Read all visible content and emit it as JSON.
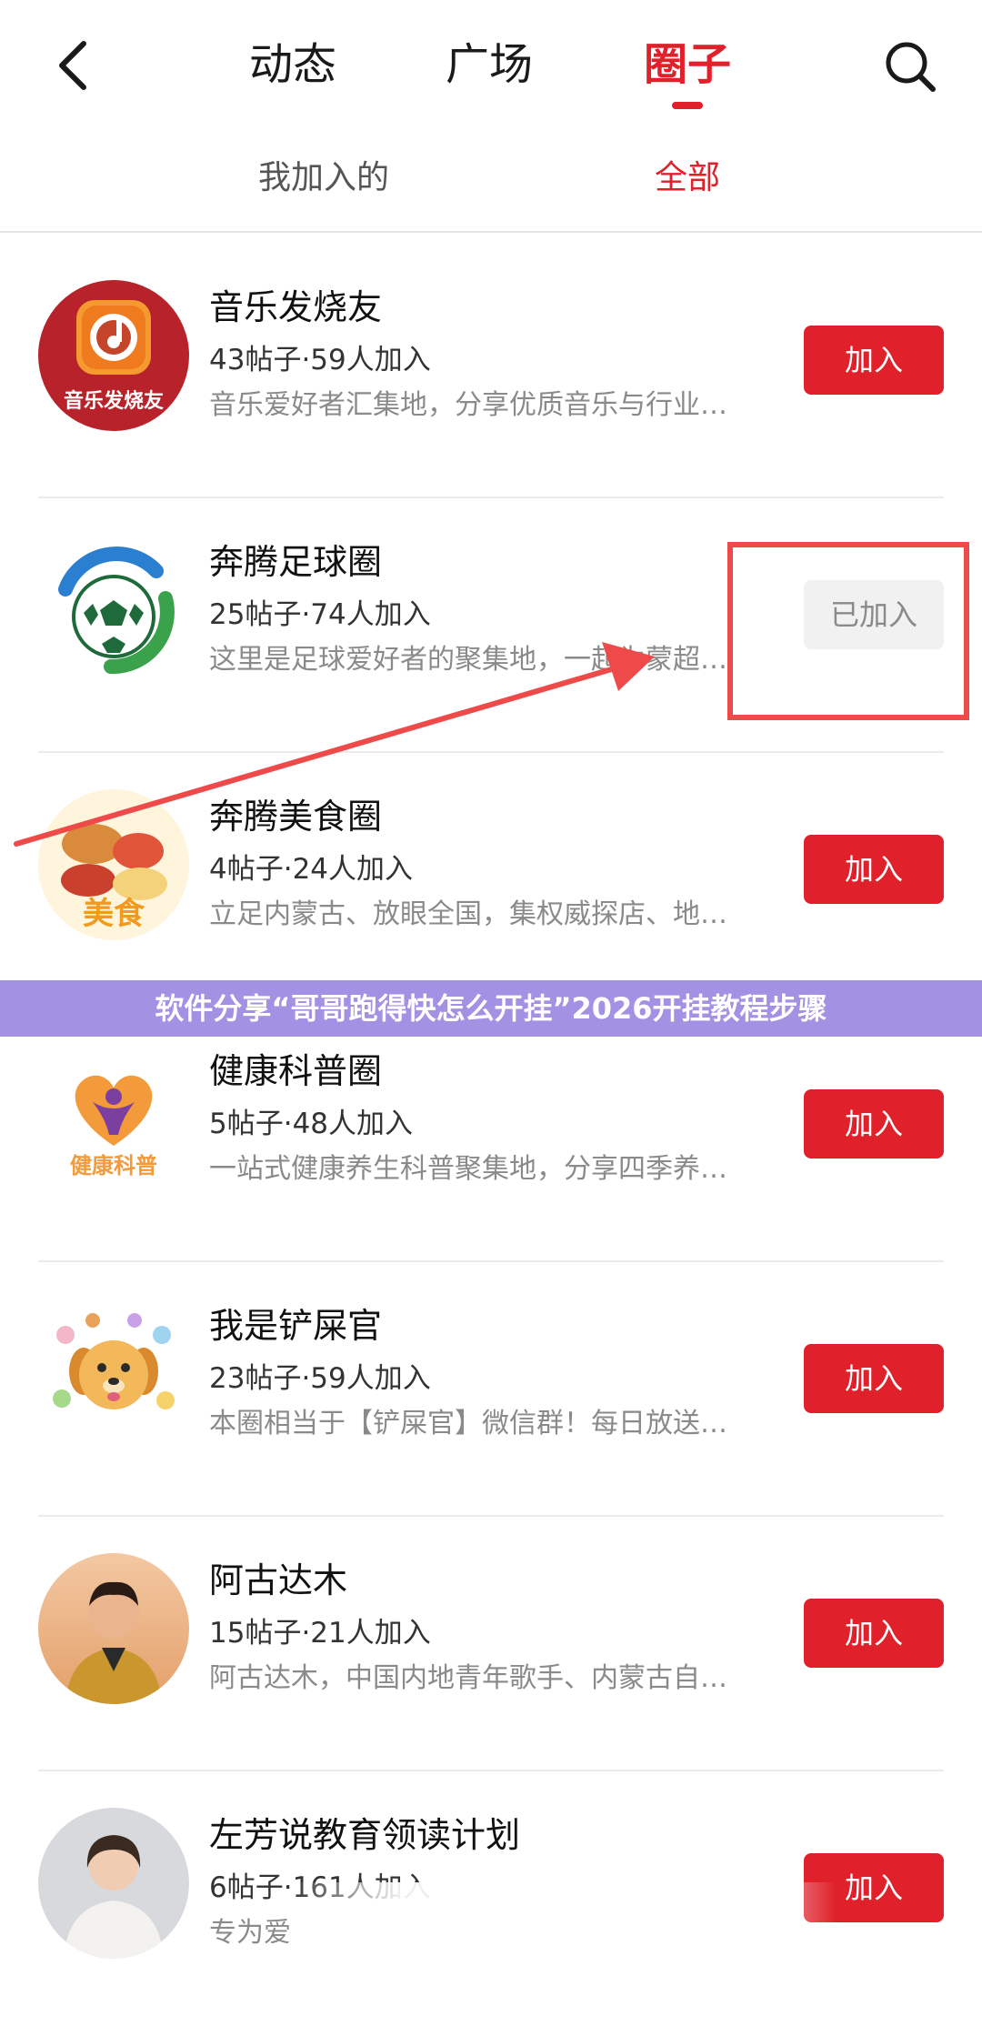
{
  "header": {
    "tabs": [
      {
        "label": "动态"
      },
      {
        "label": "广场"
      },
      {
        "label": "圈子"
      }
    ],
    "active_tab": "圈子",
    "back_icon": "chevron-left-icon",
    "search_icon": "search-icon"
  },
  "subtabs": [
    {
      "label": "我加入的"
    },
    {
      "label": "全部"
    }
  ],
  "active_subtab": "全部",
  "items": [
    {
      "title": "音乐发烧友",
      "stats": "43帖子·59人加入",
      "desc": "音乐爱好者汇集地，分享优质音乐与行业…",
      "button": "加入",
      "avatar_text": "音乐发烧友"
    },
    {
      "title": "奔腾足球圈",
      "stats": "25帖子·74人加入",
      "desc": "这里是足球爱好者的聚集地，一起为蒙超…",
      "button": "已加入"
    },
    {
      "title": "奔腾美食圈",
      "stats": "4帖子·24人加入",
      "desc": "立足内蒙古、放眼全国，集权威探店、地…",
      "button": "加入",
      "avatar_text": "美食"
    },
    {
      "title": "健康科普圈",
      "stats": "5帖子·48人加入",
      "desc": "一站式健康养生科普聚集地，分享四季养…",
      "button": "加入",
      "avatar_text": "健康科普"
    },
    {
      "title": "我是铲屎官",
      "stats": "23帖子·59人加入",
      "desc": "本圈相当于【铲屎官】微信群！每日放送…",
      "button": "加入"
    },
    {
      "title": "阿古达木",
      "stats": "15帖子·21人加入",
      "desc": "阿古达木，中国内地青年歌手、内蒙古自…",
      "button": "加入"
    },
    {
      "title": "左芳说教育领读计划",
      "stats": "6帖子·161人加入",
      "desc": "专为爱",
      "button": "加入"
    }
  ],
  "banner": {
    "text": "软件分享“哥哥跑得快怎么开挂”2026开挂教程步骤"
  },
  "colors": {
    "accent": "#e0202a",
    "banner": "#a391e3",
    "highlight": "#ef4a4a"
  }
}
